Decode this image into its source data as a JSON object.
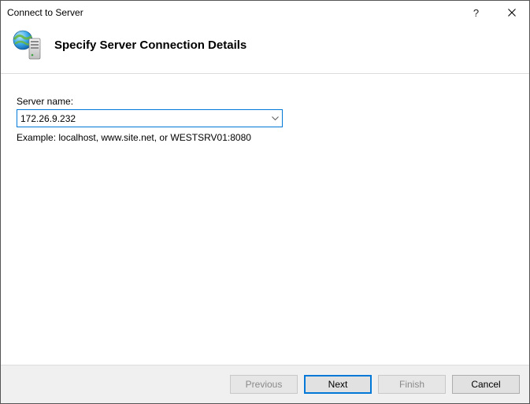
{
  "window": {
    "title": "Connect to Server"
  },
  "header": {
    "heading": "Specify Server Connection Details"
  },
  "form": {
    "server_name_label": "Server name:",
    "server_name_value": "172.26.9.232",
    "example_text": "Example: localhost, www.site.net, or WESTSRV01:8080"
  },
  "buttons": {
    "previous": "Previous",
    "next": "Next",
    "finish": "Finish",
    "cancel": "Cancel"
  },
  "icons": {
    "help": "?",
    "close": "✕"
  }
}
